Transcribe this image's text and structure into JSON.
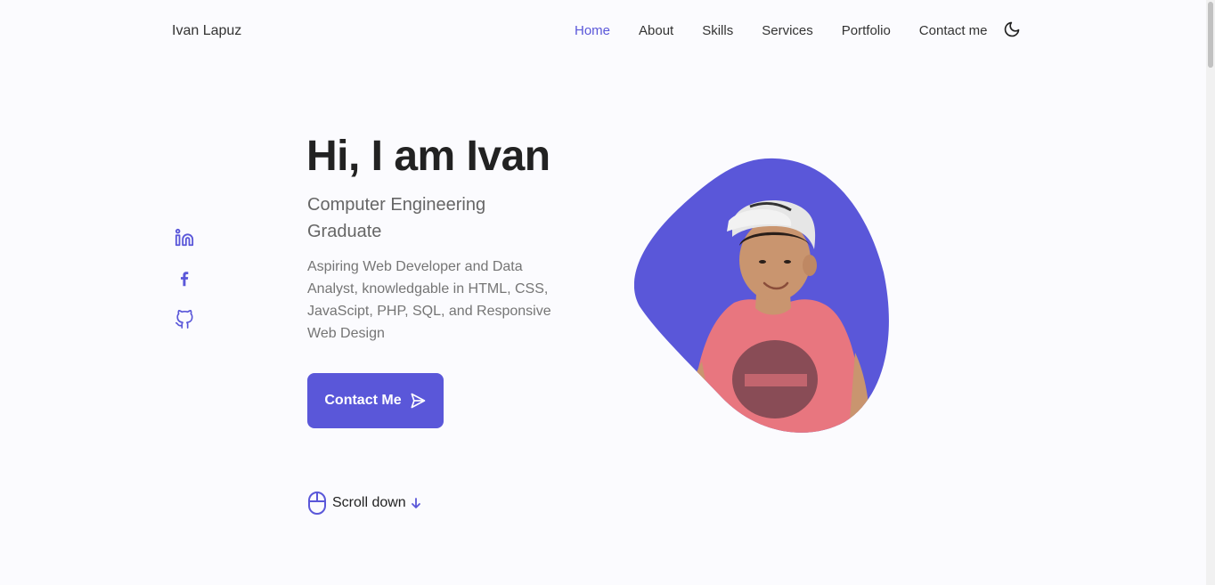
{
  "header": {
    "logo": "Ivan Lapuz",
    "nav": [
      {
        "label": "Home",
        "active": true
      },
      {
        "label": "About",
        "active": false
      },
      {
        "label": "Skills",
        "active": false
      },
      {
        "label": "Services",
        "active": false
      },
      {
        "label": "Portfolio",
        "active": false
      },
      {
        "label": "Contact me",
        "active": false
      }
    ],
    "theme_icon": "moon-icon"
  },
  "social": [
    {
      "name": "linkedin-icon"
    },
    {
      "name": "facebook-icon"
    },
    {
      "name": "github-icon"
    }
  ],
  "hero": {
    "title": "Hi, I am Ivan",
    "subtitle": "Computer Engineering Graduate",
    "description": "Aspiring Web Developer and Data Analyst, knowledgable in HTML, CSS, JavaScipt, PHP, SQL, and Responsive Web Design",
    "button_label": "Contact Me",
    "button_icon": "send-icon"
  },
  "scroll": {
    "label": "Scroll down",
    "icon": "mouse-icon",
    "arrow_icon": "arrow-down-icon"
  },
  "colors": {
    "accent": "#5a57d9",
    "background": "#fbfbfe",
    "title": "#222222",
    "text": "#757575",
    "shirt": "#e8767f",
    "skin": "#c9956f",
    "cap": "#e6e6e6"
  }
}
